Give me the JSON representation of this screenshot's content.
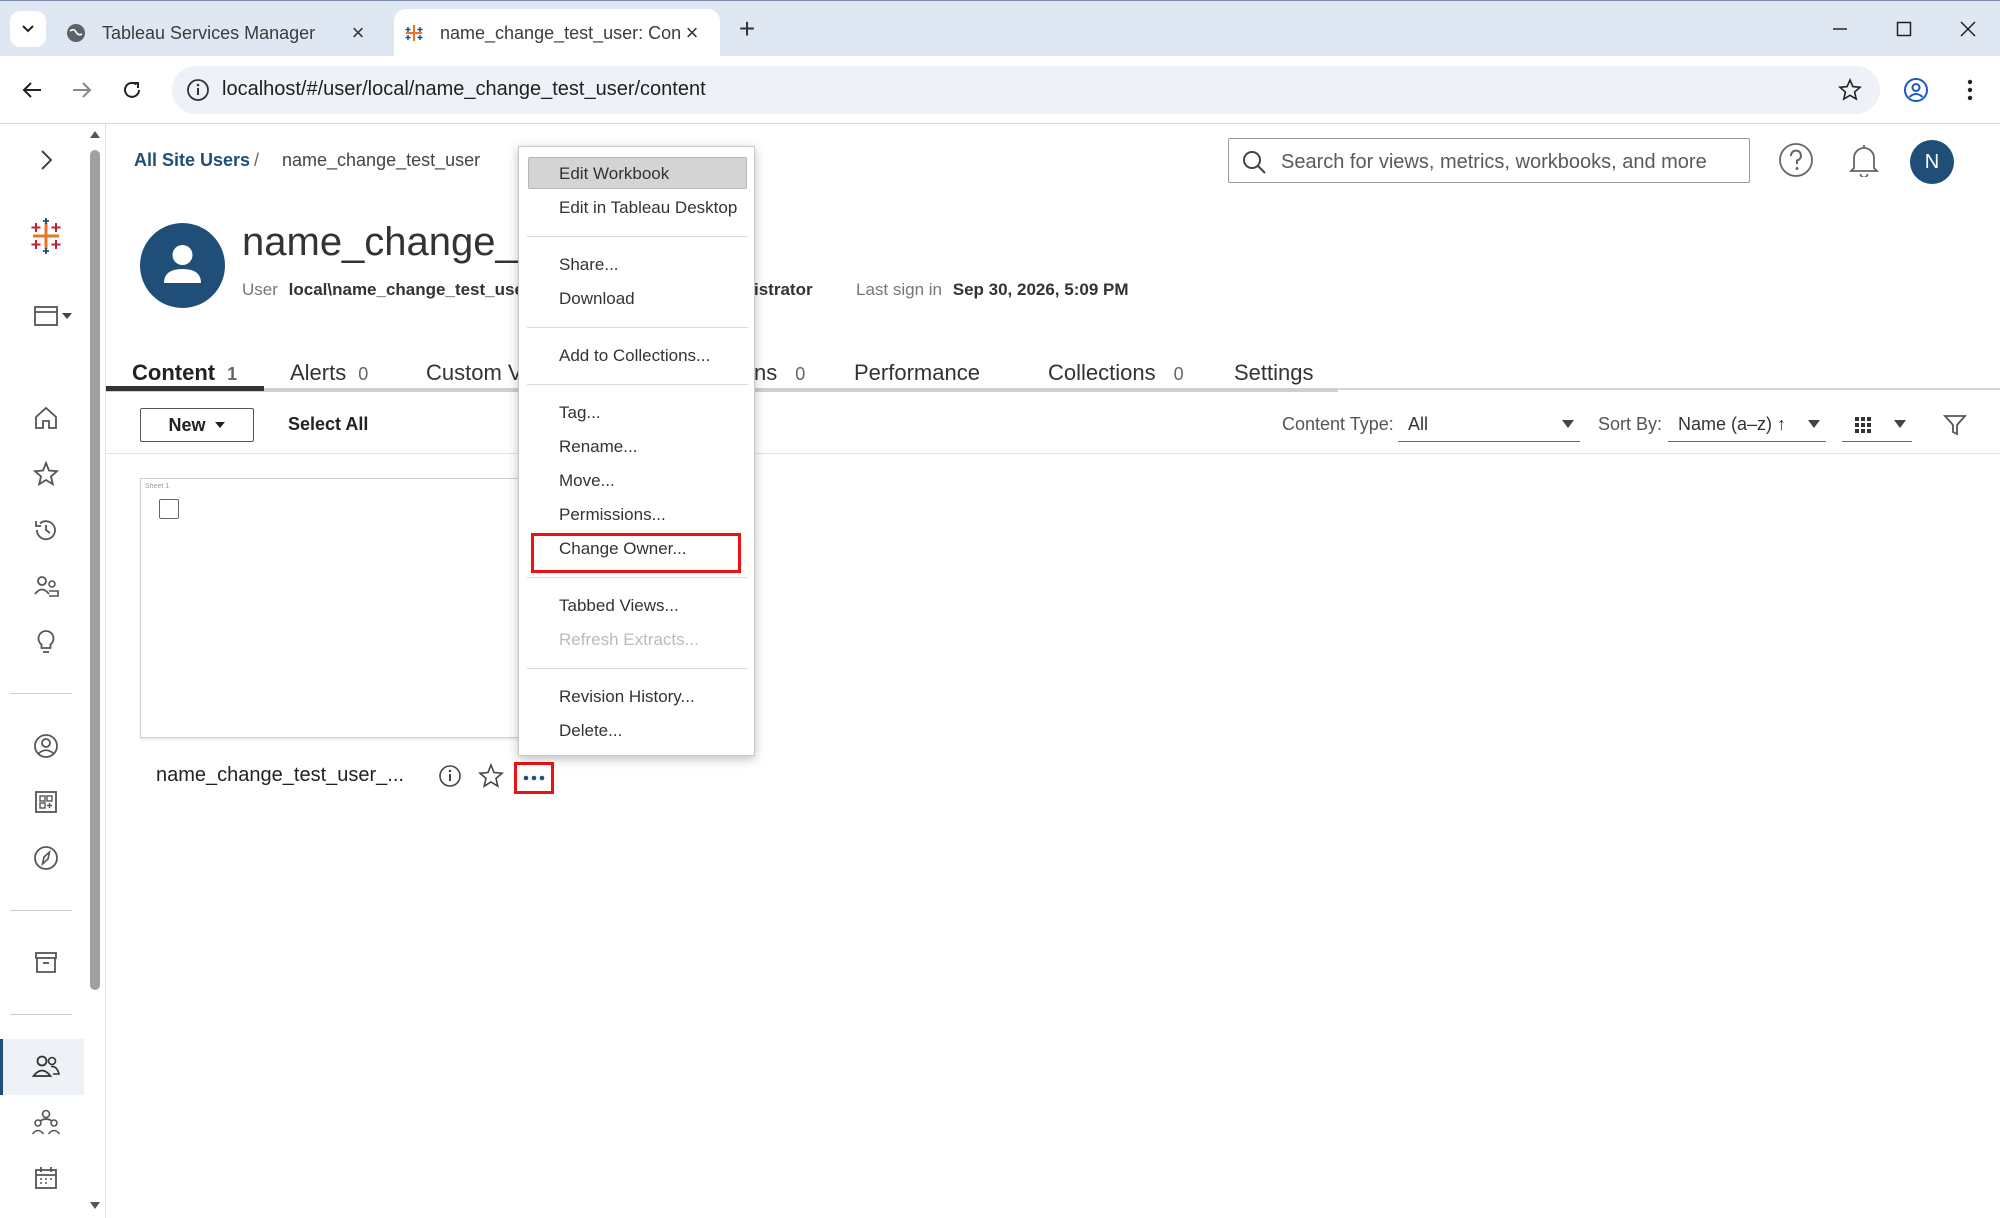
{
  "browser": {
    "tabs": [
      {
        "title": "Tableau Services Manager"
      },
      {
        "title": "name_change_test_user: Conter"
      }
    ],
    "url": "localhost/#/user/local/name_change_test_user/content"
  },
  "breadcrumb": {
    "parent": "All Site Users",
    "separator": "/",
    "current": "name_change_test_user"
  },
  "search": {
    "placeholder": "Search for views, metrics, workbooks, and more"
  },
  "header": {
    "avatar_initial": "N"
  },
  "user": {
    "name": "name_change_te",
    "user_label": "User",
    "user_value": "local\\name_change_test_use",
    "role_partial": "istrator",
    "last_sign_label": "Last sign in",
    "last_sign_value": "Sep 30, 2026, 5:09 PM"
  },
  "tabs": [
    {
      "label": "Content",
      "count": "1"
    },
    {
      "label": "Alerts",
      "count": "0"
    },
    {
      "label": "Custom V",
      "count": ""
    },
    {
      "label": "ns",
      "count": "0"
    },
    {
      "label": "Performance",
      "count": ""
    },
    {
      "label": "Collections",
      "count": "0"
    },
    {
      "label": "Settings",
      "count": ""
    }
  ],
  "actions": {
    "new_label": "New",
    "select_all": "Select All",
    "content_type_label": "Content Type:",
    "content_type_value": "All",
    "sort_by_label": "Sort By:",
    "sort_by_value": "Name (a–z) ↑"
  },
  "card": {
    "sheet_label": "Sheet 1",
    "name": "name_change_test_user_..."
  },
  "menu": {
    "items": [
      {
        "label": "Edit Workbook"
      },
      {
        "label": "Edit in Tableau Desktop"
      },
      {
        "label": "Share..."
      },
      {
        "label": "Download"
      },
      {
        "label": "Add to Collections..."
      },
      {
        "label": "Tag..."
      },
      {
        "label": "Rename..."
      },
      {
        "label": "Move..."
      },
      {
        "label": "Permissions..."
      },
      {
        "label": "Change Owner..."
      },
      {
        "label": "Tabbed Views..."
      },
      {
        "label": "Refresh Extracts..."
      },
      {
        "label": "Revision History..."
      },
      {
        "label": "Delete..."
      }
    ]
  },
  "colors": {
    "brand": "#1f4e79",
    "highlight_box": "#ee1111"
  }
}
